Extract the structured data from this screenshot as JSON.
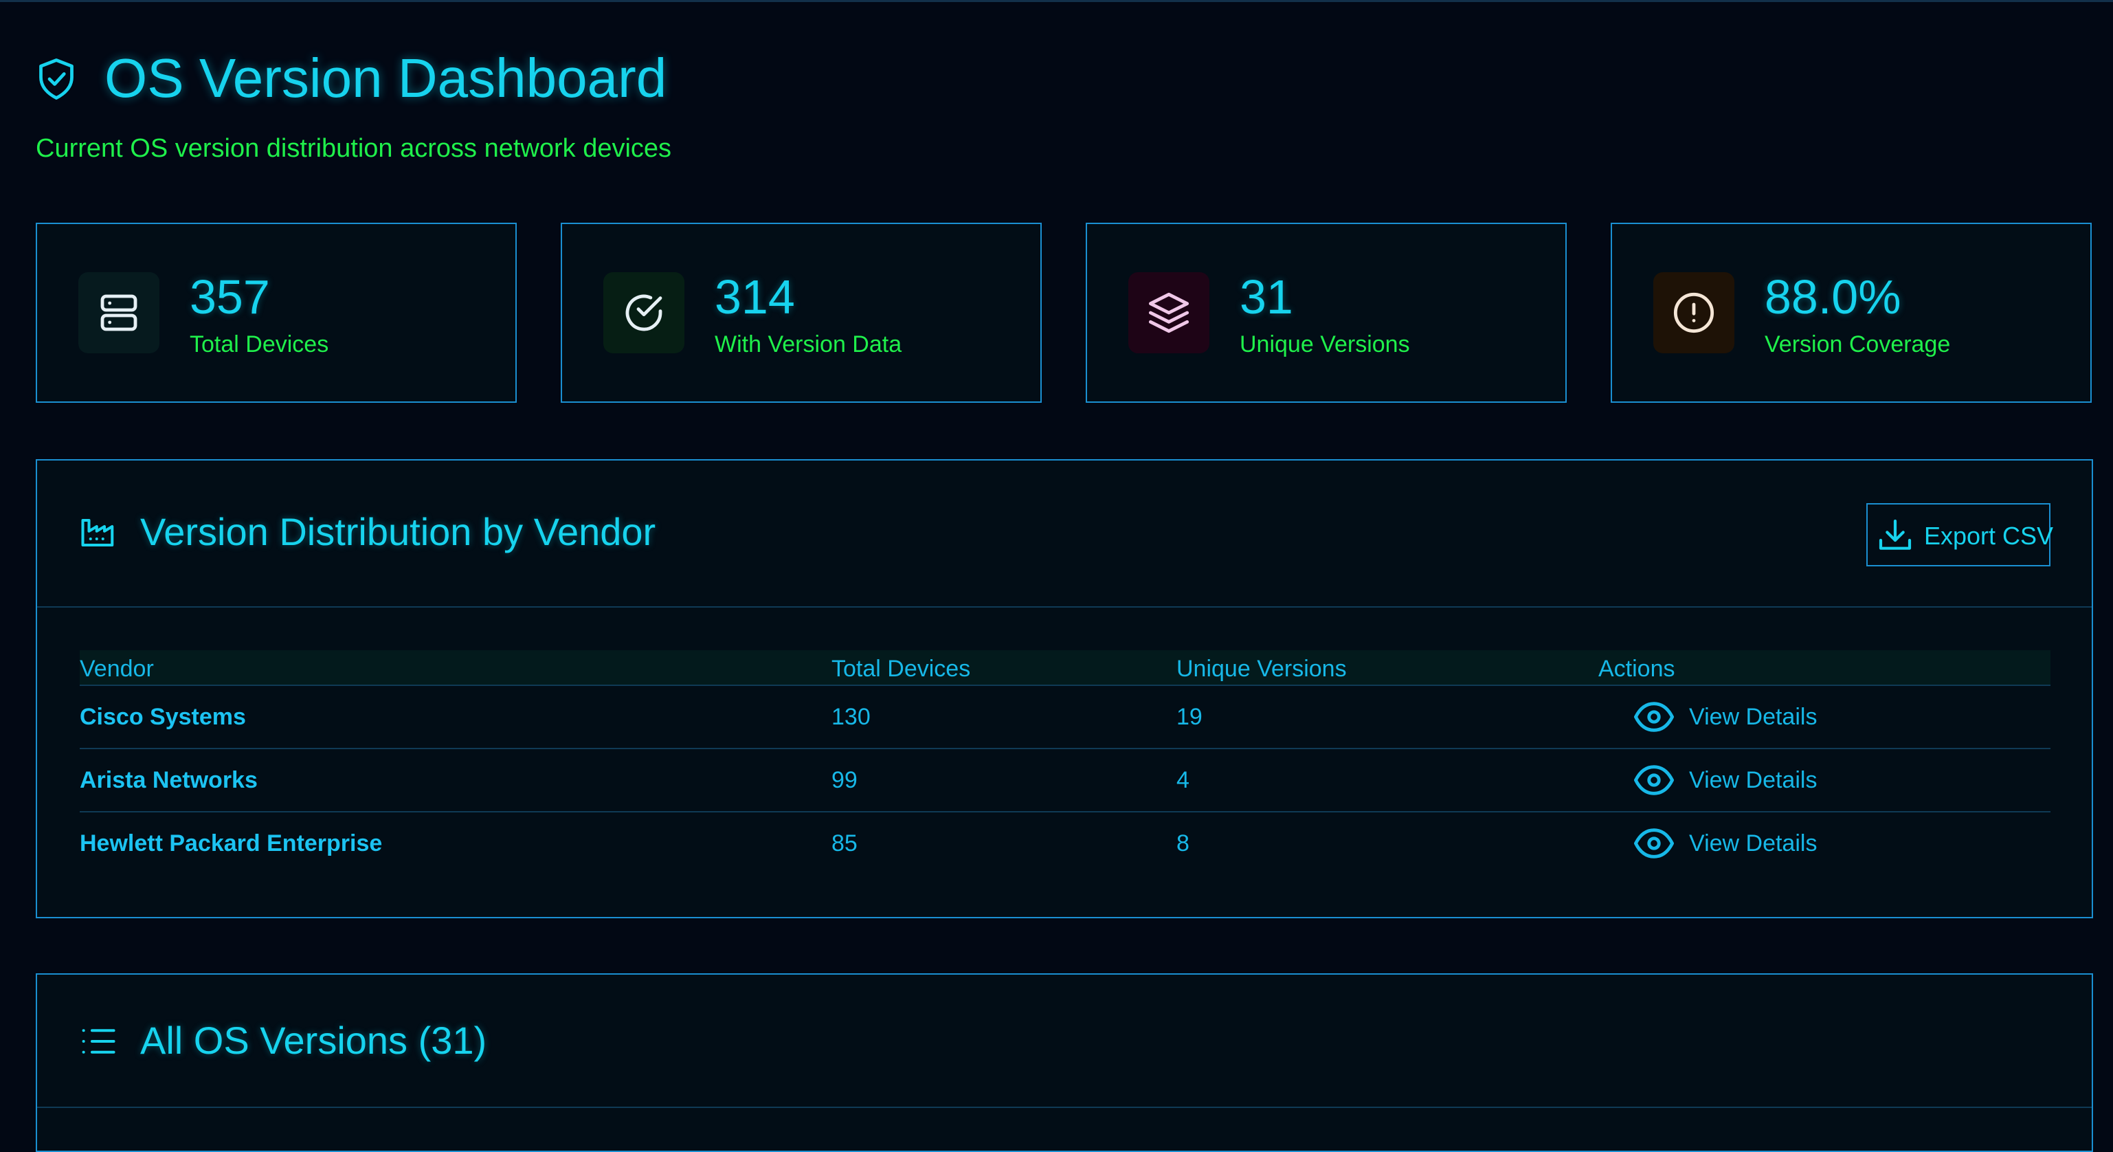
{
  "header": {
    "title": "OS Version Dashboard",
    "subtitle": "Current OS version distribution across network devices",
    "icon": "shield-check-icon"
  },
  "stats": [
    {
      "value": "357",
      "label": "Total Devices",
      "icon": "server-icon",
      "icon_color": "#e6f0f5"
    },
    {
      "value": "314",
      "label": "With Version Data",
      "icon": "check-circle-icon",
      "icon_color": "#e6f0f5"
    },
    {
      "value": "31",
      "label": "Unique Versions",
      "icon": "layers-icon",
      "icon_color": "#f0c8e8"
    },
    {
      "value": "88.0%",
      "label": "Version Coverage",
      "icon": "alert-circle-icon",
      "icon_color": "#f5e6d6"
    }
  ],
  "vendor_panel": {
    "title": "Version Distribution by Vendor",
    "icon": "factory-icon",
    "export_label": "Export CSV",
    "columns": [
      "Vendor",
      "Total Devices",
      "Unique Versions",
      "Actions"
    ],
    "rows": [
      {
        "vendor": "Cisco Systems",
        "total": "130",
        "unique": "19",
        "action": "View Details"
      },
      {
        "vendor": "Arista Networks",
        "total": "99",
        "unique": "4",
        "action": "View Details"
      },
      {
        "vendor": "Hewlett Packard Enterprise",
        "total": "85",
        "unique": "8",
        "action": "View Details"
      }
    ]
  },
  "versions_panel": {
    "title": "All OS Versions (31)",
    "icon": "list-icon"
  },
  "colors": {
    "background": "#020814",
    "accent": "#17d3ee",
    "secondary": "#1ff04b",
    "border": "#1a8fd1"
  }
}
